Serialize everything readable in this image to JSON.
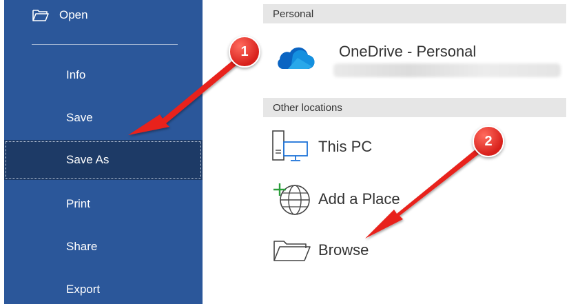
{
  "sidebar": {
    "open_label": "Open",
    "items": [
      {
        "label": "Info"
      },
      {
        "label": "Save"
      },
      {
        "label": "Save As"
      },
      {
        "label": "Print"
      },
      {
        "label": "Share"
      },
      {
        "label": "Export"
      }
    ],
    "active": "Save As"
  },
  "sections": {
    "personal": "Personal",
    "other": "Other locations"
  },
  "locations": {
    "onedrive": "OneDrive - Personal",
    "this_pc": "This PC",
    "add_place": "Add a Place",
    "browse": "Browse"
  },
  "annotations": {
    "badge1": "1",
    "badge2": "2"
  },
  "colors": {
    "sidebar": "#2b579a",
    "sidebar_active": "#1d3a66",
    "annotation": "#e8201b",
    "onedrive": "#0a64c2"
  },
  "icons": [
    "folder-open-icon",
    "onedrive-cloud-icon",
    "this-pc-icon",
    "add-place-globe-icon",
    "browse-folder-icon"
  ]
}
